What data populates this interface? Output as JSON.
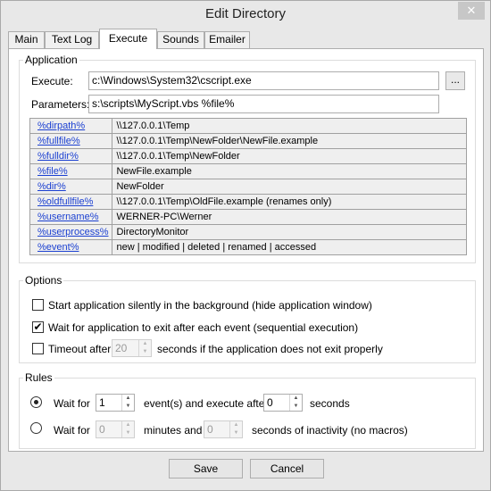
{
  "window": {
    "title": "Edit Directory",
    "close_glyph": "✕"
  },
  "tabs": [
    {
      "label": "Main"
    },
    {
      "label": "Text Log"
    },
    {
      "label": "Execute"
    },
    {
      "label": "Sounds"
    },
    {
      "label": "Emailer"
    }
  ],
  "active_tab": "Execute",
  "application": {
    "group_label": "Application",
    "execute_label": "Execute:",
    "execute_value": "c:\\Windows\\System32\\cscript.exe",
    "browse_label": "...",
    "parameters_label": "Parameters:",
    "parameters_value": "s:\\scripts\\MyScript.vbs %file%",
    "macros": [
      {
        "name": "%dirpath%",
        "value": "\\\\127.0.0.1\\Temp"
      },
      {
        "name": "%fullfile%",
        "value": "\\\\127.0.0.1\\Temp\\NewFolder\\NewFile.example"
      },
      {
        "name": "%fulldir%",
        "value": "\\\\127.0.0.1\\Temp\\NewFolder"
      },
      {
        "name": "%file%",
        "value": "NewFile.example"
      },
      {
        "name": "%dir%",
        "value": "NewFolder"
      },
      {
        "name": "%oldfullfile%",
        "value": "\\\\127.0.0.1\\Temp\\OldFile.example (renames only)"
      },
      {
        "name": "%username%",
        "value": "WERNER-PC\\Werner"
      },
      {
        "name": "%userprocess%",
        "value": "DirectoryMonitor"
      },
      {
        "name": "%event%",
        "value": "new | modified | deleted | renamed | accessed"
      }
    ]
  },
  "options": {
    "group_label": "Options",
    "silent_label": "Start application silently in the background (hide application window)",
    "silent_checked": false,
    "wait_label": "Wait for application to exit after each event (sequential execution)",
    "wait_checked": true,
    "timeout_label": "Timeout after",
    "timeout_checked": false,
    "timeout_value": "20",
    "timeout_suffix": "seconds if the application does not exit properly",
    "check_glyph": "✔"
  },
  "rules": {
    "group_label": "Rules",
    "rule1_prefix": "Wait for",
    "rule1_selected": true,
    "rule1_events": "1",
    "rule1_mid": "event(s) and execute after",
    "rule1_seconds": "0",
    "rule1_suffix": "seconds",
    "rule2_prefix": "Wait for",
    "rule2_selected": false,
    "rule2_minutes": "0",
    "rule2_mid": "minutes and",
    "rule2_seconds": "0",
    "rule2_suffix": "seconds of inactivity (no macros)"
  },
  "footer": {
    "save_label": "Save",
    "cancel_label": "Cancel"
  },
  "spin_glyphs": {
    "up": "▲",
    "down": "▼"
  }
}
